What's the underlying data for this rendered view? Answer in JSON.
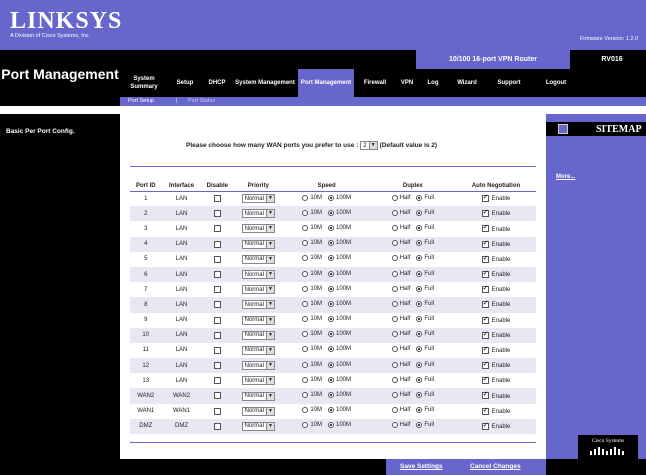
{
  "header": {
    "logo": "LINKSYS",
    "logo_sub": "A Division of Cisco Systems, Inc.",
    "firmware": "Firmware Version: 1.2.0",
    "product_name": "10/100 16-port VPN Router",
    "model": "RV016"
  },
  "section_title": "Port Management",
  "nav": {
    "tabs": [
      {
        "label": "System Summary",
        "active": false
      },
      {
        "label": "Setup",
        "active": false
      },
      {
        "label": "DHCP",
        "active": false
      },
      {
        "label": "System Management",
        "active": false
      },
      {
        "label": "Port Management",
        "active": true
      },
      {
        "label": "Firewall",
        "active": false
      },
      {
        "label": "VPN",
        "active": false
      },
      {
        "label": "Log",
        "active": false
      },
      {
        "label": "Wizard",
        "active": false
      },
      {
        "label": "Support",
        "active": false
      },
      {
        "label": "Logout",
        "active": false
      }
    ],
    "subtabs": {
      "setup": "Port Setup",
      "sep": "|",
      "status": "Port Status"
    }
  },
  "left_label": "Basic Per Port Config.",
  "wan": {
    "prompt": "Please choose how many WAN ports you prefer to use :",
    "value": "2",
    "note": "(Default value is 2)"
  },
  "table": {
    "headers": [
      "Port ID",
      "Interface",
      "Disable",
      "Priority",
      "Speed",
      "Duplex",
      "Auto Negotiation"
    ],
    "speed_options": [
      "10M",
      "100M"
    ],
    "duplex_options": [
      "Half",
      "Full"
    ],
    "enable_label": "Enable",
    "rows": [
      {
        "id": "1",
        "iface": "LAN",
        "disabled": false,
        "priority": "Normal",
        "speed": "100M",
        "duplex": "Full",
        "auto": true
      },
      {
        "id": "2",
        "iface": "LAN",
        "disabled": false,
        "priority": "Normal",
        "speed": "100M",
        "duplex": "Full",
        "auto": true
      },
      {
        "id": "3",
        "iface": "LAN",
        "disabled": false,
        "priority": "Normal",
        "speed": "100M",
        "duplex": "Full",
        "auto": true
      },
      {
        "id": "4",
        "iface": "LAN",
        "disabled": false,
        "priority": "Normal",
        "speed": "100M",
        "duplex": "Full",
        "auto": true
      },
      {
        "id": "5",
        "iface": "LAN",
        "disabled": false,
        "priority": "Normal",
        "speed": "100M",
        "duplex": "Full",
        "auto": true
      },
      {
        "id": "6",
        "iface": "LAN",
        "disabled": false,
        "priority": "Normal",
        "speed": "100M",
        "duplex": "Full",
        "auto": true
      },
      {
        "id": "7",
        "iface": "LAN",
        "disabled": false,
        "priority": "Normal",
        "speed": "100M",
        "duplex": "Full",
        "auto": true
      },
      {
        "id": "8",
        "iface": "LAN",
        "disabled": false,
        "priority": "Normal",
        "speed": "100M",
        "duplex": "Full",
        "auto": true
      },
      {
        "id": "9",
        "iface": "LAN",
        "disabled": false,
        "priority": "Normal",
        "speed": "100M",
        "duplex": "Full",
        "auto": true
      },
      {
        "id": "10",
        "iface": "LAN",
        "disabled": false,
        "priority": "Normal",
        "speed": "100M",
        "duplex": "Full",
        "auto": true
      },
      {
        "id": "11",
        "iface": "LAN",
        "disabled": false,
        "priority": "Normal",
        "speed": "100M",
        "duplex": "Full",
        "auto": true
      },
      {
        "id": "12",
        "iface": "LAN",
        "disabled": false,
        "priority": "Normal",
        "speed": "100M",
        "duplex": "Full",
        "auto": true
      },
      {
        "id": "13",
        "iface": "LAN",
        "disabled": false,
        "priority": "Normal",
        "speed": "100M",
        "duplex": "Full",
        "auto": true
      },
      {
        "id": "WAN2",
        "iface": "WAN2",
        "disabled": false,
        "priority": "Normal",
        "speed": "100M",
        "duplex": "Full",
        "auto": true
      },
      {
        "id": "WAN1",
        "iface": "WAN1",
        "disabled": false,
        "priority": "Normal",
        "speed": "100M",
        "duplex": "Full",
        "auto": true
      },
      {
        "id": "DMZ",
        "iface": "DMZ",
        "disabled": false,
        "priority": "Normal",
        "speed": "100M",
        "duplex": "Full",
        "auto": true
      }
    ]
  },
  "sitemap": {
    "label": "SITEMAP",
    "more": "More..."
  },
  "cisco": "Cisco Systems",
  "footer": {
    "save": "Save Settings",
    "cancel": "Cancel Changes"
  },
  "colors": {
    "brand": "#6666cc",
    "dark": "#000000"
  }
}
